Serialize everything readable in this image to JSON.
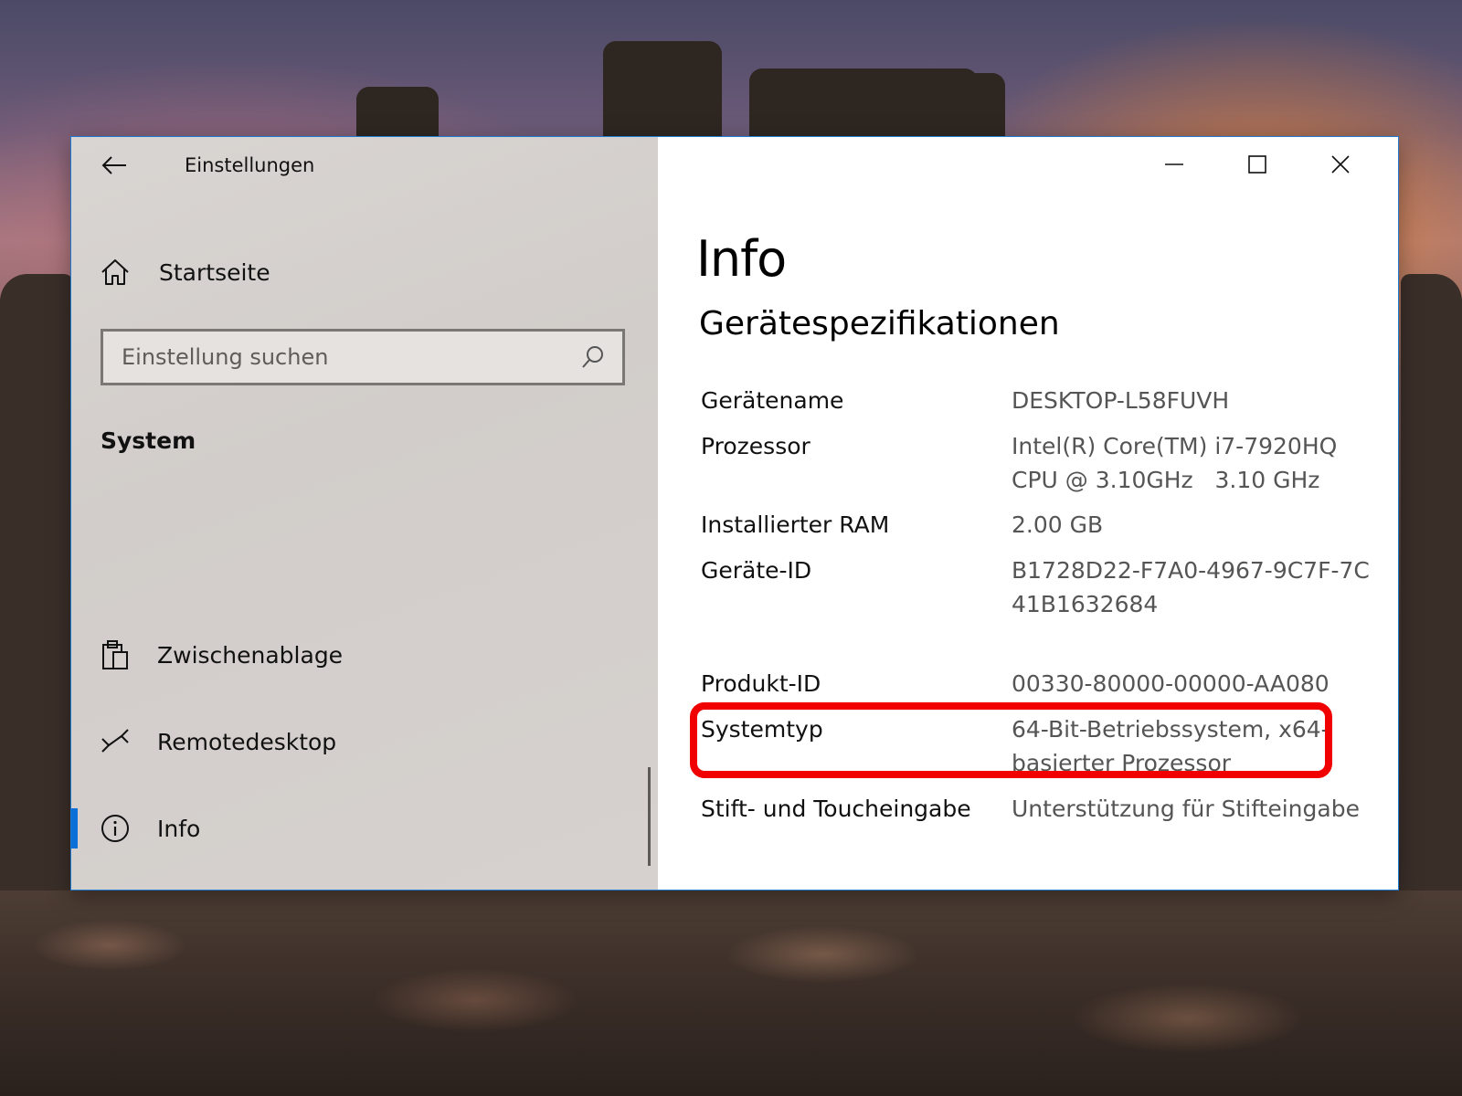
{
  "window": {
    "title": "Einstellungen"
  },
  "sidebar": {
    "home_label": "Startseite",
    "search_placeholder": "Einstellung suchen",
    "section_title": "System",
    "items": [
      {
        "label": "Zwischenablage",
        "icon": "clipboard-icon"
      },
      {
        "label": "Remotedesktop",
        "icon": "remote-desktop-icon"
      },
      {
        "label": "Info",
        "icon": "info-icon",
        "selected": true
      }
    ]
  },
  "main": {
    "page_title": "Info",
    "section_heading": "Gerätespezifikationen",
    "specs": [
      {
        "label": "Gerätename",
        "value": "DESKTOP-L58FUVH"
      },
      {
        "label": "Prozessor",
        "value": "Intel(R) Core(TM) i7-7920HQ CPU @ 3.10GHz   3.10 GHz"
      },
      {
        "label": "Installierter RAM",
        "value": "2.00 GB"
      },
      {
        "label": "Geräte-ID",
        "value": "B1728D22-F7A0-4967-9C7F-7C41B1632684"
      },
      {
        "label": "Produkt-ID",
        "value": "00330-80000-00000-AA080"
      },
      {
        "label": "Systemtyp",
        "value": "64-Bit-Betriebssystem, x64-basierter Prozessor"
      },
      {
        "label": "Stift- und Toucheingabe",
        "value": "Unterstützung für Stifteingabe"
      }
    ],
    "highlight_color": "#f00000"
  },
  "colors": {
    "accent": "#0a6fd6",
    "window_border": "#1f7ad1"
  }
}
